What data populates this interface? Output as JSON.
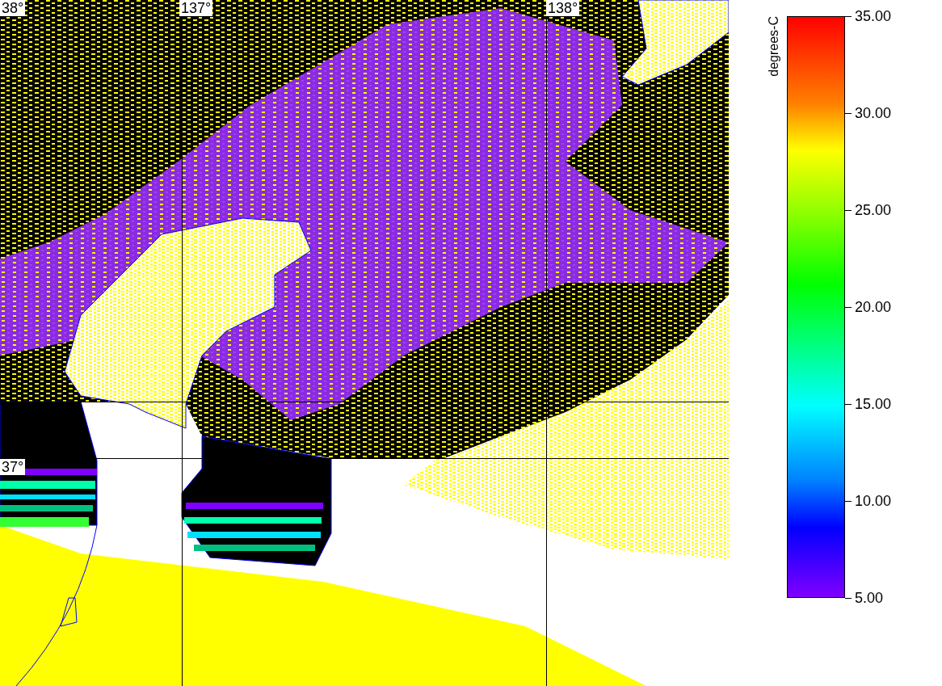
{
  "map": {
    "latitude_labels": [
      "38°",
      "37°"
    ],
    "longitude_labels": [
      "137°",
      "138°"
    ]
  },
  "colorbar": {
    "title": "degrees-C",
    "ticks": [
      "35.00",
      "30.00",
      "25.00",
      "20.00",
      "15.00",
      "10.00",
      "5.00"
    ]
  }
}
